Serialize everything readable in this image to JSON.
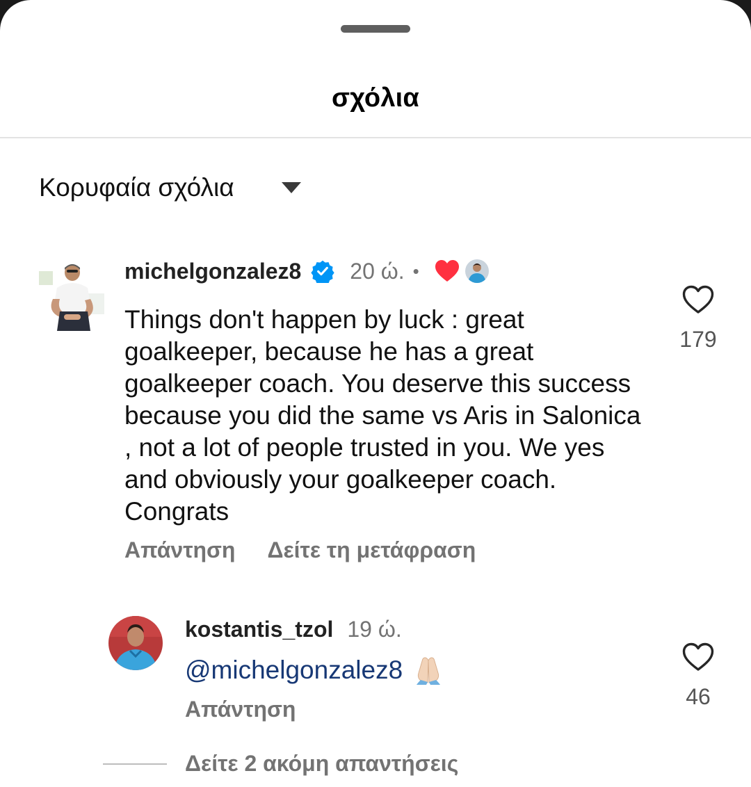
{
  "header": {
    "title": "σχόλια"
  },
  "sort": {
    "label": "Κορυφαία σχόλια"
  },
  "comments": [
    {
      "username": "michelgonzalez8",
      "verified": true,
      "time": "20 ώ.",
      "separator": "•",
      "text": "Things don't happen by luck : great goalkeeper, because he has a great goalkeeper coach. You deserve this success because you did the same vs Aris in Salonica , not a lot of people trusted in you. We yes and obviously your goalkeeper coach. Congrats",
      "reply_label": "Απάντηση",
      "translate_label": "Δείτε τη μετάφραση",
      "likes": "179",
      "icons": [
        "verified-badge-icon",
        "heart-reaction-icon",
        "author-liked-avatar",
        "heart-outline-icon"
      ]
    }
  ],
  "reply": {
    "username": "kostantis_tzol",
    "time": "19 ώ.",
    "mention": "@michelgonzalez8",
    "emoji": "folded-hands-emoji",
    "reply_label": "Απάντηση",
    "likes": "46"
  },
  "more_replies": "Δείτε 2 ακόμη απαντήσεις",
  "colors": {
    "verified": "#0095f6",
    "heart": "#ff3040",
    "mention": "#173875",
    "muted": "#737373"
  }
}
